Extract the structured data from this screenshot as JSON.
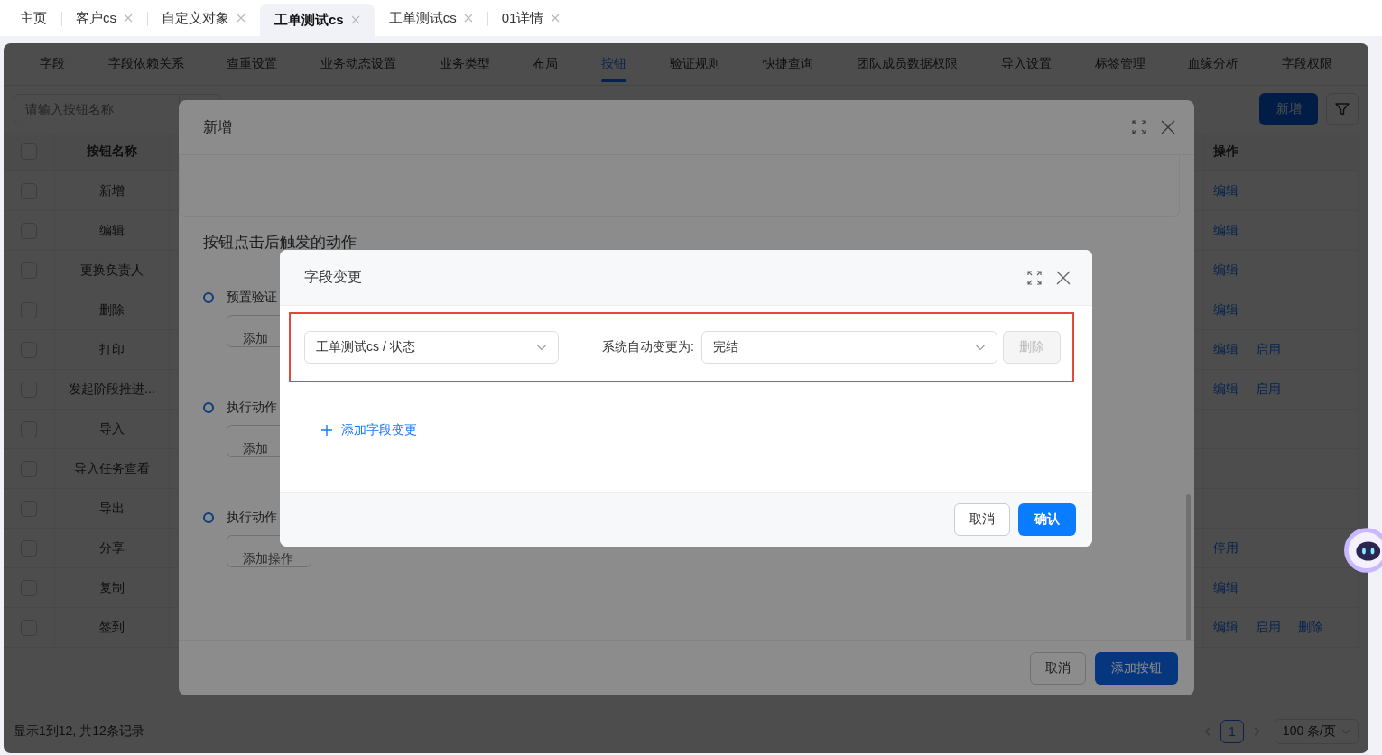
{
  "top_tabs": [
    {
      "label": "主页",
      "selected": false,
      "closable": false
    },
    {
      "label": "客户cs",
      "selected": false,
      "closable": true
    },
    {
      "label": "自定义对象",
      "selected": false,
      "closable": true
    },
    {
      "label": "工单测试cs",
      "selected": true,
      "closable": true
    },
    {
      "label": "工单测试cs",
      "selected": false,
      "closable": true
    },
    {
      "label": "01详情",
      "selected": false,
      "closable": true
    }
  ],
  "sub_tabs": [
    {
      "label": "字段",
      "selected": false
    },
    {
      "label": "字段依赖关系",
      "selected": false
    },
    {
      "label": "查重设置",
      "selected": false
    },
    {
      "label": "业务动态设置",
      "selected": false
    },
    {
      "label": "业务类型",
      "selected": false
    },
    {
      "label": "布局",
      "selected": false
    },
    {
      "label": "按钮",
      "selected": true
    },
    {
      "label": "验证规则",
      "selected": false
    },
    {
      "label": "快捷查询",
      "selected": false
    },
    {
      "label": "团队成员数据权限",
      "selected": false
    },
    {
      "label": "导入设置",
      "selected": false
    },
    {
      "label": "标签管理",
      "selected": false
    },
    {
      "label": "血缘分析",
      "selected": false
    },
    {
      "label": "字段权限",
      "selected": false
    }
  ],
  "toolbar": {
    "search": {
      "placeholder": "请输入按钮名称"
    },
    "add_button": "新增"
  },
  "table": {
    "header_checked": false,
    "columns": [
      "按钮名称",
      "操作"
    ],
    "rows": [
      {
        "name": "新增",
        "checked": false,
        "actions": [
          "编辑"
        ]
      },
      {
        "name": "编辑",
        "checked": false,
        "actions": [
          "编辑"
        ]
      },
      {
        "name": "更换负责人",
        "checked": false,
        "actions": [
          "编辑"
        ]
      },
      {
        "name": "删除",
        "checked": false,
        "actions": [
          "编辑"
        ]
      },
      {
        "name": "打印",
        "checked": false,
        "actions": [
          "编辑",
          "启用"
        ]
      },
      {
        "name": "发起阶段推进...",
        "checked": false,
        "actions": [
          "编辑",
          "启用"
        ]
      },
      {
        "name": "导入",
        "checked": false,
        "actions": []
      },
      {
        "name": "导入任务查看",
        "checked": false,
        "actions": []
      },
      {
        "name": "导出",
        "checked": false,
        "actions": []
      },
      {
        "name": "分享",
        "checked": false,
        "actions": [
          "停用"
        ]
      },
      {
        "name": "复制",
        "checked": false,
        "actions": [
          "编辑"
        ]
      },
      {
        "name": "签到",
        "checked": false,
        "actions": [
          "编辑",
          "启用",
          "删除"
        ]
      }
    ]
  },
  "footer": {
    "summary": "显示1到12, 共12条记录",
    "pages": [
      {
        "label": "1",
        "selected": true
      }
    ],
    "page_size": "100 条/页"
  },
  "modal": {
    "title": "新增",
    "section_title": "按钮点击后触发的动作",
    "steps": [
      {
        "label": "预置验证",
        "button": "添加"
      },
      {
        "label": "执行动作",
        "button": "添加"
      },
      {
        "label": "执行动作",
        "button": "添加操作"
      }
    ],
    "buttons": [
      {
        "label": "取消",
        "kind": "default"
      },
      {
        "label": "添加按钮",
        "kind": "primary"
      }
    ]
  },
  "dialog": {
    "title": "字段变更",
    "rule": {
      "field": "工单测试cs / 状态",
      "label": "系统自动变更为:",
      "value": "完结",
      "delete_button": {
        "label": "删除",
        "disabled": true
      }
    },
    "add_link": "添加字段变更",
    "buttons": [
      {
        "label": "取消",
        "kind": "default"
      },
      {
        "label": "确认",
        "kind": "primary"
      }
    ]
  }
}
